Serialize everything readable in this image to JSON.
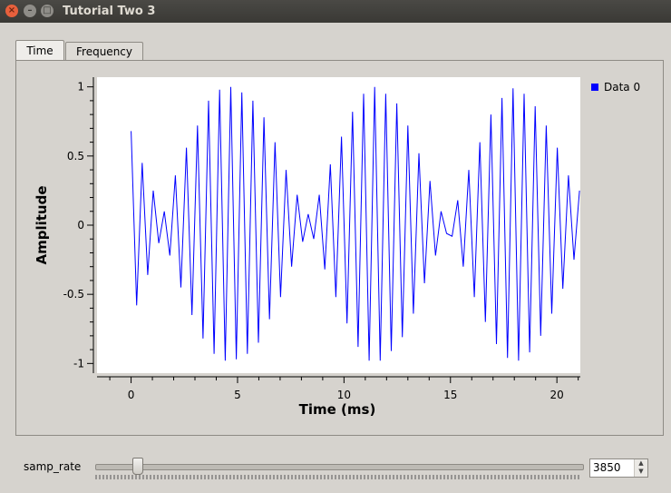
{
  "window": {
    "title": "Tutorial Two 3"
  },
  "tabs": [
    {
      "label": "Time",
      "active": true
    },
    {
      "label": "Frequency",
      "active": false
    }
  ],
  "chart_data": {
    "type": "line",
    "xlabel": "Time (ms)",
    "ylabel": "Amplitude",
    "xlim": [
      -1.6,
      21.1
    ],
    "ylim": [
      -1.07,
      1.07
    ],
    "xticks": [
      0,
      5,
      10,
      15,
      20
    ],
    "yticks": [
      1,
      0.5,
      0,
      -0.5,
      -1
    ],
    "ytick_labels": [
      "1",
      "0.5",
      "0",
      "-0.5",
      "-1"
    ],
    "legend": {
      "placement": "right",
      "entries": [
        "Data 0"
      ]
    },
    "series": [
      {
        "name": "Data 0",
        "color": "#0000ff",
        "x": [
          0.0,
          0.26,
          0.52,
          0.78,
          1.04,
          1.3,
          1.56,
          1.82,
          2.08,
          2.34,
          2.6,
          2.86,
          3.12,
          3.38,
          3.64,
          3.9,
          4.16,
          4.42,
          4.68,
          4.94,
          5.2,
          5.46,
          5.72,
          5.98,
          6.24,
          6.5,
          6.76,
          7.02,
          7.28,
          7.54,
          7.8,
          8.06,
          8.32,
          8.58,
          8.84,
          9.1,
          9.36,
          9.62,
          9.88,
          10.14,
          10.4,
          10.66,
          10.92,
          11.18,
          11.44,
          11.7,
          11.96,
          12.22,
          12.48,
          12.74,
          13.0,
          13.26,
          13.52,
          13.78,
          14.04,
          14.3,
          14.56,
          14.82,
          15.08,
          15.34,
          15.6,
          15.86,
          16.12,
          16.38,
          16.64,
          16.9,
          17.16,
          17.42,
          17.68,
          17.94,
          18.2,
          18.46,
          18.72,
          18.98,
          19.24,
          19.5,
          19.76,
          20.02,
          20.28,
          20.54,
          20.8,
          21.06
        ],
        "y": [
          0.68,
          -0.58,
          0.45,
          -0.36,
          0.25,
          -0.13,
          0.1,
          -0.22,
          0.36,
          -0.45,
          0.56,
          -0.65,
          0.72,
          -0.82,
          0.9,
          -0.93,
          0.98,
          -0.98,
          1.0,
          -0.97,
          0.96,
          -0.93,
          0.9,
          -0.85,
          0.78,
          -0.68,
          0.6,
          -0.52,
          0.4,
          -0.3,
          0.22,
          -0.12,
          0.08,
          -0.1,
          0.22,
          -0.32,
          0.44,
          -0.52,
          0.64,
          -0.71,
          0.82,
          -0.88,
          0.95,
          -0.98,
          1.0,
          -0.98,
          0.95,
          -0.91,
          0.88,
          -0.81,
          0.72,
          -0.64,
          0.52,
          -0.42,
          0.32,
          -0.22,
          0.1,
          -0.06,
          -0.08,
          0.18,
          -0.3,
          0.4,
          -0.52,
          0.6,
          -0.7,
          0.8,
          -0.86,
          0.92,
          -0.96,
          0.99,
          -0.98,
          0.95,
          -0.92,
          0.86,
          -0.8,
          0.72,
          -0.64,
          0.56,
          -0.46,
          0.36,
          -0.25,
          0.25
        ]
      }
    ]
  },
  "slider": {
    "label": "samp_rate",
    "value": "3850",
    "position_fraction": 0.085
  }
}
